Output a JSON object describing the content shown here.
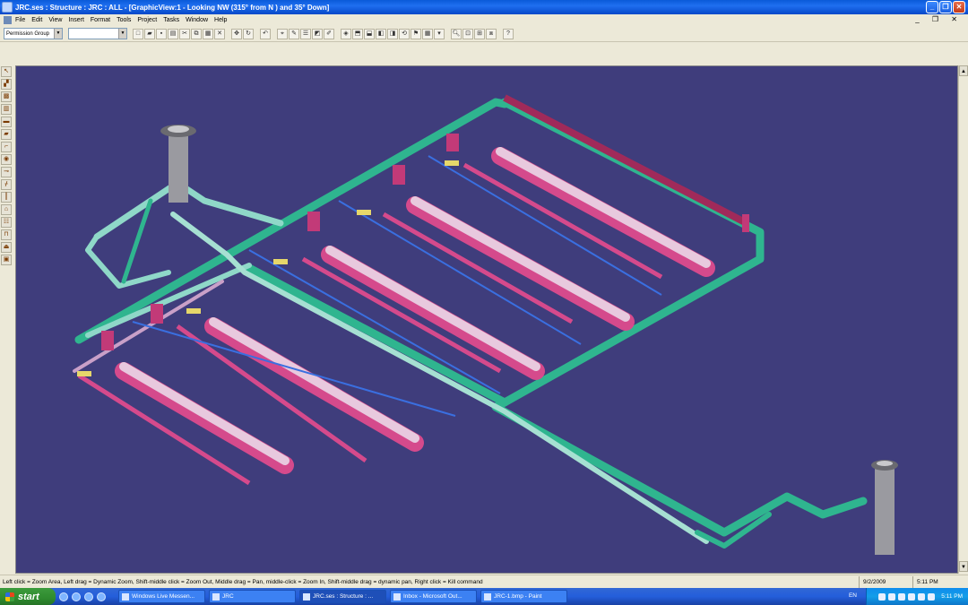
{
  "window": {
    "title": "JRC.ses : Structure : JRC : ALL - [GraphicView:1 - Looking NW (315° from N ) and 35° Down]"
  },
  "menu": [
    "File",
    "Edit",
    "View",
    "Insert",
    "Format",
    "Tools",
    "Project",
    "Tasks",
    "Window",
    "Help"
  ],
  "toolbar": {
    "permission_group": "Permission Group",
    "second_combo": ""
  },
  "status": {
    "message": "Left click = Zoom Area, Left drag = Dynamic Zoom, Shift-middle click = Zoom Out, Middle drag = Pan, middle-click = Zoom In, Shift-middle drag = dynamic pan, Right click = Kill command",
    "date": "9/2/2009",
    "time": "5:11 PM"
  },
  "taskbar": {
    "start_label": "start",
    "tasks": [
      {
        "label": "Windows Live Messen..."
      },
      {
        "label": "JRC"
      },
      {
        "label": "JRC.ses : Structure : ..."
      },
      {
        "label": "Inbox - Microsoft Out..."
      },
      {
        "label": "JRC-1.bmp - Paint"
      }
    ],
    "language": "EN",
    "clock": "5:11 PM"
  },
  "colors": {
    "viewport_bg": "#3f3d7c",
    "pipe_green": "#2fb58f",
    "pipe_pink": "#d54a8c",
    "pipe_light": "#e8c9de",
    "tank_gray": "#9a9aa0"
  }
}
